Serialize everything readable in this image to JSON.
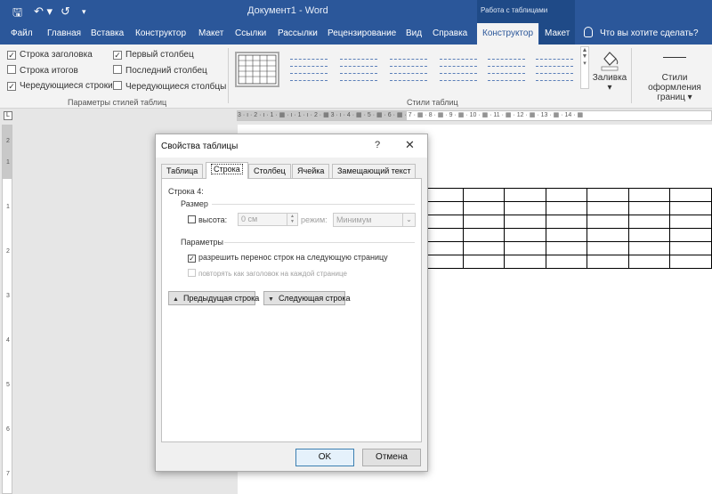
{
  "titlebar": {
    "document_title": "Документ1 - Word",
    "context_group": "Работа с таблицами",
    "save_icon": "save-icon",
    "undo_icon": "undo-icon",
    "redo_icon": "redo-icon"
  },
  "tabs": [
    "Файл",
    "Главная",
    "Вставка",
    "Конструктор",
    "Макет",
    "Ссылки",
    "Рассылки",
    "Рецензирование",
    "Вид",
    "Справка",
    "Конструктор",
    "Макет"
  ],
  "active_tab": "Конструктор",
  "tell_me": "Что вы хотите сделать?",
  "ribbon": {
    "style_options": {
      "header_row": {
        "label": "Строка заголовка",
        "checked": true
      },
      "total_row": {
        "label": "Строка итогов",
        "checked": false
      },
      "banded_rows": {
        "label": "Чередующиеся строки",
        "checked": true
      },
      "first_column": {
        "label": "Первый столбец",
        "checked": true
      },
      "last_column": {
        "label": "Последний столбец",
        "checked": false
      },
      "banded_columns": {
        "label": "Чередующиеся столбцы",
        "checked": false
      },
      "group_label": "Параметры стилей таблиц"
    },
    "table_styles_label": "Стили таблиц",
    "shading_label": "Заливка",
    "border_styles_label_1": "Стили оформления",
    "border_styles_label_2": "границ"
  },
  "ruler_h_text": "3 · ı · 2 · ı · 1 · ▦ · ı · 1 · ı · 2 · ▦ 3 · ı · 4 · ▦ · 5 · ▦ · 6 · ▦ · 7 · ▦ · 8 · ▦ · 9 · ▦ · 10 · ▦ · 11 · ▦ · 12 · ▦ · 13 · ▦ · 14 · ▦",
  "dialog": {
    "title": "Свойства таблицы",
    "help": "?",
    "close": "✕",
    "tabs": [
      "Таблица",
      "Строка",
      "Столбец",
      "Ячейка",
      "Замещающий текст"
    ],
    "active_tab": "Строка",
    "row_label": "Строка 4:",
    "size_section": "Размер",
    "height_label": "высота:",
    "height_checked": false,
    "height_value": "0 см",
    "mode_label": "режим:",
    "mode_value": "Минимум",
    "params_section": "Параметры",
    "allow_break": {
      "label": "разрешить перенос строк на следующую страницу",
      "checked": true
    },
    "repeat_header": {
      "label": "повторять как заголовок на каждой странице",
      "checked": false,
      "enabled": false
    },
    "prev_row": "Предыдущая строка",
    "next_row": "Следующая строка",
    "ok": "OK",
    "cancel": "Отмена"
  }
}
